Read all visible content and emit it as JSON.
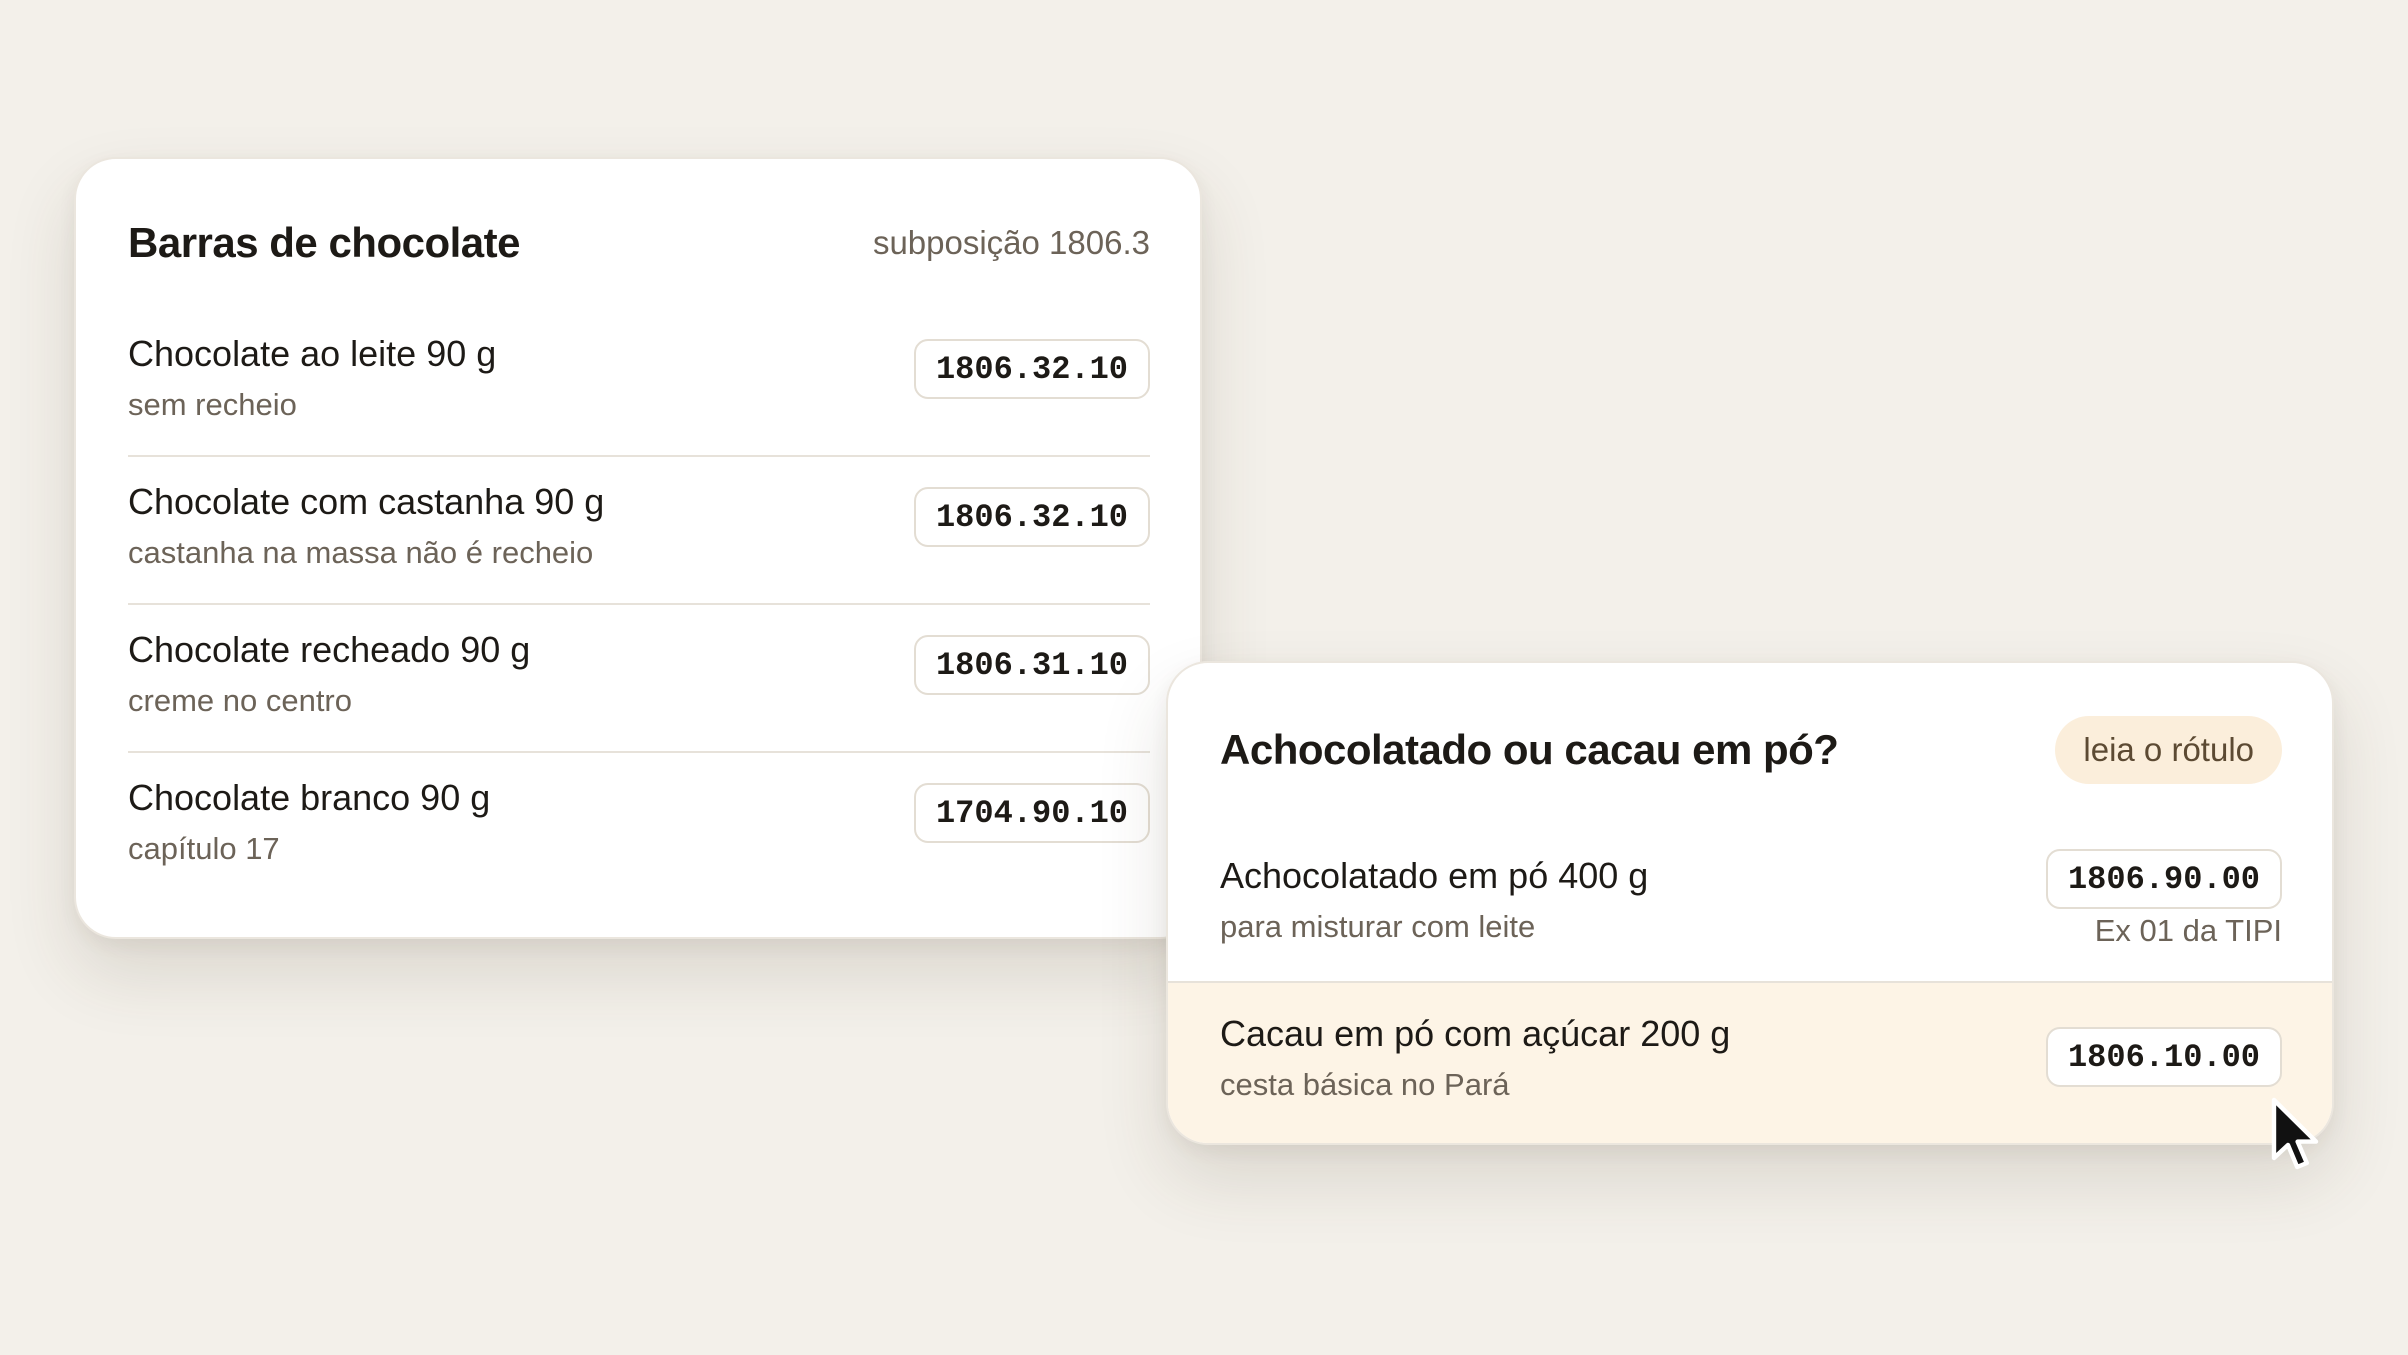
{
  "bars_card": {
    "title": "Barras de chocolate",
    "subtitle": "subposição 1806.3",
    "items": [
      {
        "name": "Chocolate ao leite 90 g",
        "note": "sem recheio",
        "code": "1806.32.10"
      },
      {
        "name": "Chocolate com castanha 90 g",
        "note": "castanha na massa não é recheio",
        "code": "1806.32.10"
      },
      {
        "name": "Chocolate recheado 90 g",
        "note": "creme no centro",
        "code": "1806.31.10"
      },
      {
        "name": "Chocolate branco 90 g",
        "note": "capítulo 17",
        "code": "1704.90.10"
      }
    ]
  },
  "powder_card": {
    "title": "Achocolatado ou cacau em pó?",
    "tag": "leia o rótulo",
    "items": [
      {
        "name": "Achocolatado em pó 400 g",
        "note": "para misturar com leite",
        "code": "1806.90.00",
        "aside": "Ex 01 da TIPI"
      },
      {
        "name": "Cacau em pó com açúcar 200 g",
        "note": "cesta básica no Pará",
        "code": "1806.10.00"
      }
    ]
  },
  "colors": {
    "background": "#f3f0ea",
    "card": "#ffffff",
    "tag_background": "#fbeedb",
    "highlight_row": "#fdf4e6",
    "muted_text": "#6c6358"
  },
  "icons": {
    "cursor": "mouse-pointer-icon"
  }
}
